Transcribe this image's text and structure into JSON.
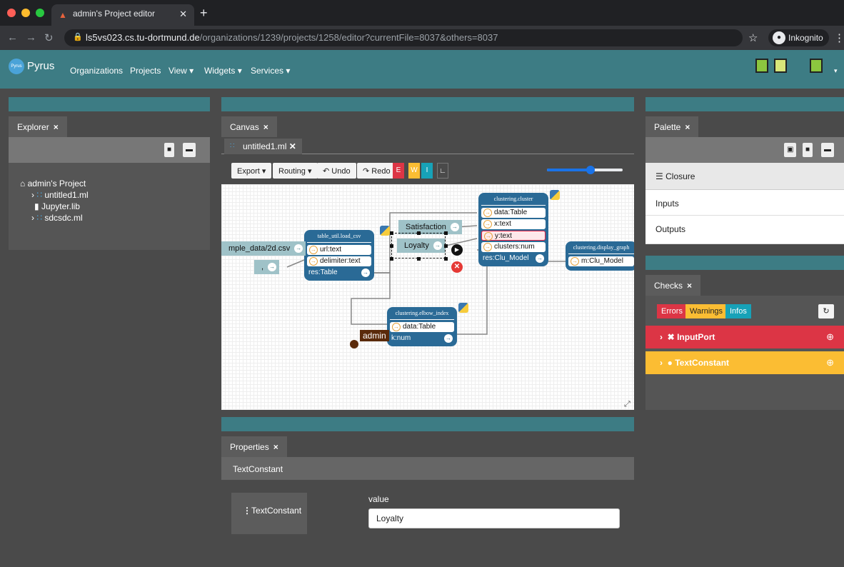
{
  "browser": {
    "tab_title": "admin's Project editor",
    "url_host": "ls5vs023.cs.tu-dortmund.de",
    "url_path": "/organizations/1239/projects/1258/editor?currentFile=8037&others=8037",
    "profile_label": "Inkognito"
  },
  "nav": {
    "brand": "Pyrus",
    "logo_text": "Pyrus",
    "items": [
      "Organizations",
      "Projects",
      "View",
      "Widgets",
      "Services"
    ]
  },
  "explorer": {
    "tab_label": "Explorer",
    "tree": {
      "root": "admin's Project",
      "items": [
        "untitled1.ml",
        "Jupyter.lib",
        "sdcsdc.ml"
      ]
    }
  },
  "canvas": {
    "tab_label": "Canvas",
    "file_tab": "untitled1.ml",
    "toolbar": {
      "export": "Export",
      "routing": "Routing",
      "undo": "Undo",
      "redo": "Redo",
      "e": "E",
      "w": "W",
      "i": "I"
    },
    "zoom_fraction": 0.58,
    "nodes": {
      "load_csv": {
        "title": "table_util.load_csv",
        "inputs": [
          "url:text",
          "delimiter:text"
        ],
        "output": "res:Table"
      },
      "cluster": {
        "title": "clustering.cluster",
        "inputs": [
          "data:Table",
          "x:text",
          "y:text",
          "clusters:num"
        ],
        "output": "res:Clu_Model"
      },
      "display_graph": {
        "title": "clustering.display_graph",
        "inputs": [
          "m:Clu_Model"
        ]
      },
      "elbow": {
        "title": "clustering.elbow_index",
        "inputs": [
          "data:Table"
        ],
        "output": "k:num"
      }
    },
    "constants": {
      "csv_path": "mple_data/2d.csv",
      "delimiter": ",",
      "satisfaction": "Satisfaction",
      "loyalty": "Loyalty"
    },
    "cursor_user": "admin"
  },
  "palette": {
    "tab_label": "Palette",
    "group": "Closure",
    "items": [
      "Inputs",
      "Outputs"
    ]
  },
  "checks": {
    "tab_label": "Checks",
    "filters": {
      "errors": "Errors",
      "warnings": "Warnings",
      "infos": "Infos"
    },
    "entries": [
      {
        "label": "InputPort",
        "level": "error"
      },
      {
        "label": "TextConstant",
        "level": "warning"
      }
    ]
  },
  "properties": {
    "tab_label": "Properties",
    "header": "TextConstant",
    "nav_item": "TextConstant",
    "field_label": "value",
    "field_value": "Loyalty"
  },
  "colors": {
    "teal": "#3d7c84",
    "node_blue": "#2a6a96",
    "error": "#dc3545",
    "warning": "#fbbd33",
    "info": "#17a2b8"
  }
}
